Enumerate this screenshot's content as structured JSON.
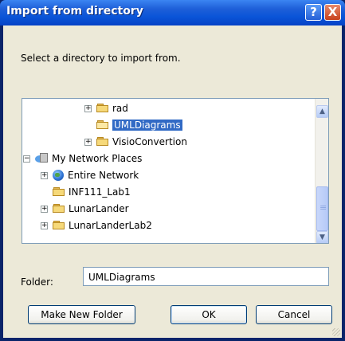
{
  "window": {
    "title": "Import from directory"
  },
  "instruction": "Select a directory to import from.",
  "tree": {
    "items": [
      {
        "label": "rad",
        "expander": "+",
        "icon": "folder-icon"
      },
      {
        "label": "UMLDiagrams",
        "expander": "",
        "icon": "folder-open-icon",
        "selected": true
      },
      {
        "label": "VisioConvertion",
        "expander": "+",
        "icon": "folder-icon"
      },
      {
        "label": "My Network Places",
        "expander": "−",
        "icon": "network-places-icon"
      },
      {
        "label": "Entire Network",
        "expander": "+",
        "icon": "globe-icon"
      },
      {
        "label": "INF111_Lab1",
        "expander": "",
        "icon": "folder-icon"
      },
      {
        "label": "LunarLander",
        "expander": "+",
        "icon": "folder-icon"
      },
      {
        "label": "LunarLanderLab2",
        "expander": "+",
        "icon": "folder-icon"
      }
    ]
  },
  "folder_field": {
    "label": "Folder:",
    "value": "UMLDiagrams"
  },
  "buttons": {
    "make_new_folder": "Make New Folder",
    "ok": "OK",
    "cancel": "Cancel"
  },
  "titlebar_buttons": {
    "help": "?",
    "close": "X"
  }
}
